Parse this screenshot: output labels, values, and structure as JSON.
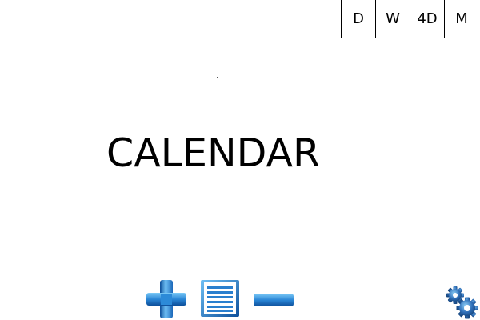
{
  "view_modes": {
    "day": "D",
    "week": "W",
    "four_day": "4D",
    "month": "M"
  },
  "title": "CALENDAR",
  "toolbar": {
    "add_icon": "plus-icon",
    "list_icon": "list-icon",
    "remove_icon": "minus-icon",
    "settings_icon": "gears-icon"
  },
  "colors": {
    "icon_blue": "#1f7fd0",
    "icon_blue_light": "#6fc0f5",
    "icon_blue_dark": "#0d4f9a",
    "settings_blue": "#2f6fb8"
  }
}
